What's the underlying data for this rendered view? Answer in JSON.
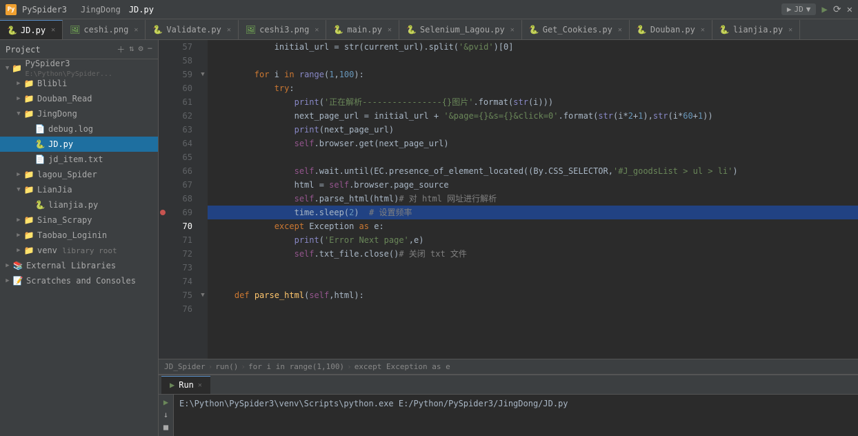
{
  "titlebar": {
    "app_name": "PySpider3",
    "tabs": [
      "JingDong",
      "JD.py"
    ],
    "run_config": "JD",
    "controls": [
      "▶",
      "⟳",
      "✕"
    ]
  },
  "file_tabs": [
    {
      "label": "JD.py",
      "type": "py",
      "active": true
    },
    {
      "label": "ceshi.png",
      "type": "img",
      "active": false
    },
    {
      "label": "Validate.py",
      "type": "py",
      "active": false
    },
    {
      "label": "ceshi3.png",
      "type": "img",
      "active": false
    },
    {
      "label": "main.py",
      "type": "py",
      "active": false
    },
    {
      "label": "Selenium_Lagou.py",
      "type": "py",
      "active": false
    },
    {
      "label": "Get_Cookies.py",
      "type": "py",
      "active": false
    },
    {
      "label": "Douban.py",
      "type": "py",
      "active": false
    },
    {
      "label": "lianjia.py",
      "type": "py",
      "active": false
    }
  ],
  "sidebar": {
    "project_label": "Project",
    "root": {
      "label": "PySpider3",
      "path": "E:\\Python\\PySpider...",
      "children": [
        {
          "label": "Blibli",
          "type": "folder",
          "expanded": false,
          "indent": 1
        },
        {
          "label": "Douban_Read",
          "type": "folder",
          "expanded": false,
          "indent": 1
        },
        {
          "label": "JingDong",
          "type": "folder",
          "expanded": true,
          "indent": 1,
          "children": [
            {
              "label": "debug.log",
              "type": "file",
              "indent": 2
            },
            {
              "label": "JD.py",
              "type": "py",
              "indent": 2,
              "selected": true
            },
            {
              "label": "jd_item.txt",
              "type": "txt",
              "indent": 2
            }
          ]
        },
        {
          "label": "lagou_Spider",
          "type": "folder",
          "expanded": false,
          "indent": 1
        },
        {
          "label": "LianJia",
          "type": "folder",
          "expanded": true,
          "indent": 1,
          "children": [
            {
              "label": "lianjia.py",
              "type": "py",
              "indent": 2
            }
          ]
        },
        {
          "label": "Sina_Scrapy",
          "type": "folder",
          "expanded": false,
          "indent": 1
        },
        {
          "label": "Taobao_Loginin",
          "type": "folder",
          "expanded": false,
          "indent": 1
        },
        {
          "label": "venv",
          "type": "folder",
          "expanded": false,
          "indent": 1,
          "extra": "library root"
        }
      ]
    },
    "external_libraries": "External Libraries",
    "scratches": "Scratches and Consoles"
  },
  "code": {
    "lines": [
      {
        "num": 57,
        "text": "            initial_url = str(current_url).split('&pvid')[0]"
      },
      {
        "num": 58,
        "text": ""
      },
      {
        "num": 59,
        "text": "        for i in range(1,100):"
      },
      {
        "num": 60,
        "text": "            try:"
      },
      {
        "num": 61,
        "text": "                print('正在解析----------------{}图片'.format(str(i)))"
      },
      {
        "num": 62,
        "text": "                next_page_url = initial_url + '&page={}&s={}&click=0'.format(str(i*2+1),str(i*60+1))"
      },
      {
        "num": 63,
        "text": "                print(next_page_url)"
      },
      {
        "num": 64,
        "text": "                self.browser.get(next_page_url)"
      },
      {
        "num": 65,
        "text": ""
      },
      {
        "num": 66,
        "text": "                self.wait.until(EC.presence_of_element_located((By.CSS_SELECTOR,'#J_goodsList > ul > li')"
      },
      {
        "num": 67,
        "text": "                html = self.browser.page_source"
      },
      {
        "num": 68,
        "text": "                self.parse_html(html)# 对 html 网址进行解析"
      },
      {
        "num": 69,
        "text": "                time.sleep(2)  # 设置频率"
      },
      {
        "num": 70,
        "text": "            except Exception as e:"
      },
      {
        "num": 71,
        "text": "                print('Error Next page',e)"
      },
      {
        "num": 72,
        "text": "                self.txt_file.close()# 关闭 txt 文件"
      },
      {
        "num": 73,
        "text": ""
      },
      {
        "num": 74,
        "text": ""
      },
      {
        "num": 75,
        "text": "    def parse_html(self,html):"
      },
      {
        "num": 76,
        "text": ""
      }
    ]
  },
  "breadcrumb": {
    "parts": [
      "JD_Spider",
      "run()",
      "for i in range(1,100)",
      "except Exception as e"
    ]
  },
  "bottom_panel": {
    "tab_label": "Run",
    "run_name": "JD",
    "output": "E:\\Python\\PySpider3\\venv\\Scripts\\python.exe E:/Python/PySpider3/JingDong/JD.py"
  }
}
